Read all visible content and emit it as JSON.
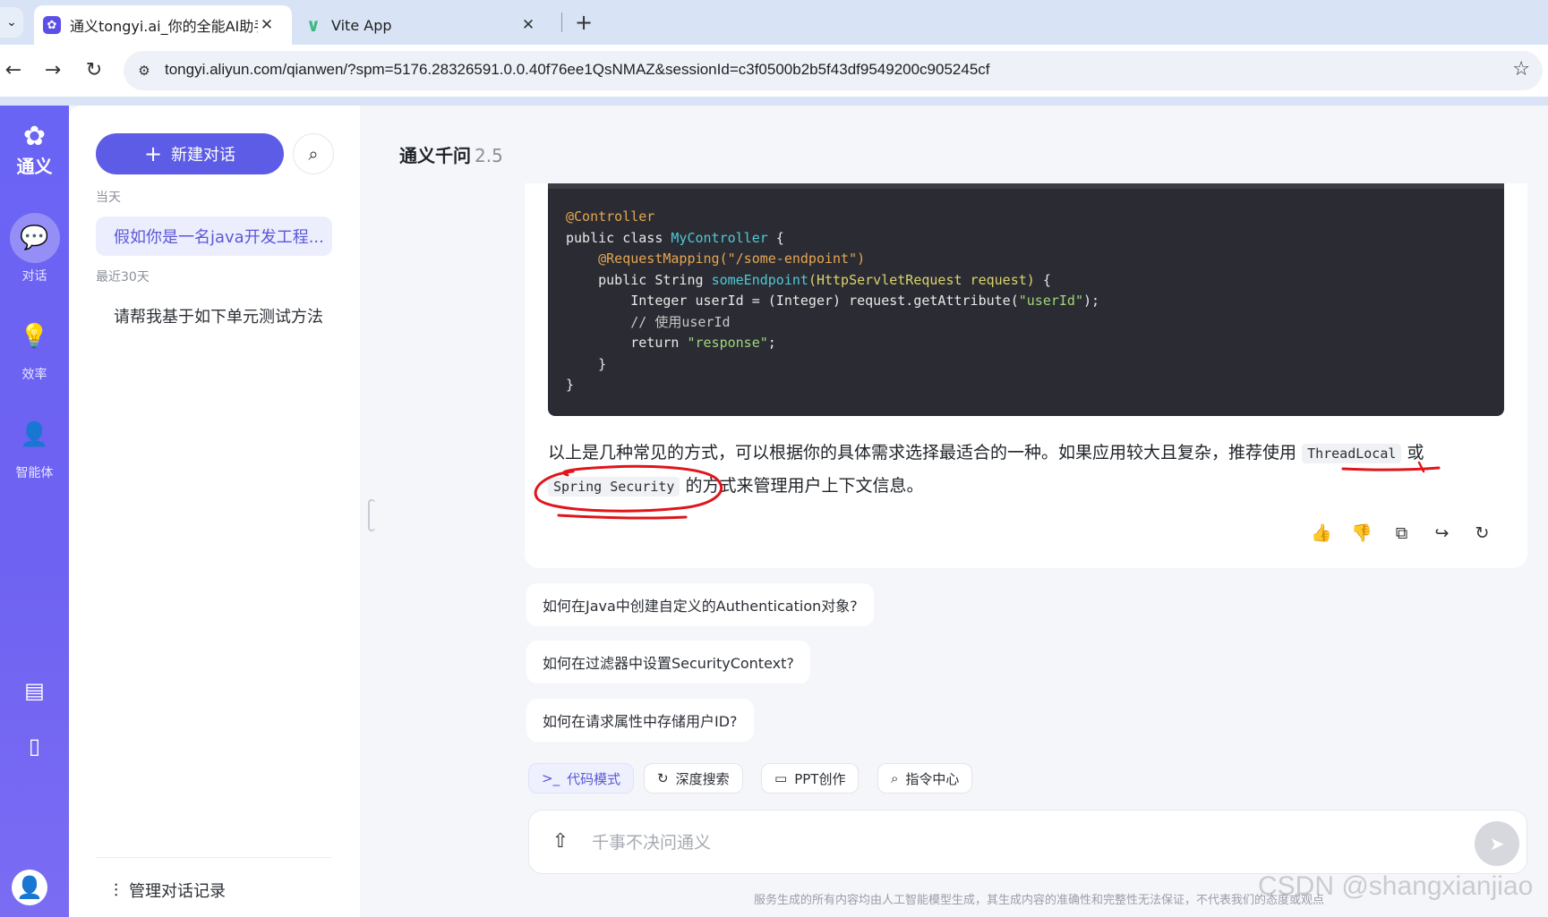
{
  "browser": {
    "tabs": [
      {
        "title": "通义tongyi.ai_你的全能AI助手-",
        "favicon": "tongyi-logo-icon",
        "active": true
      },
      {
        "title": "Vite App",
        "favicon": "vite-logo-icon",
        "active": false
      }
    ],
    "url": "tongyi.aliyun.com/qianwen/?spm=5176.28326591.0.0.40f76ee1QsNMAZ&sessionId=c3f0500b2b5f43df9549200c905245cf"
  },
  "rail": {
    "logo_text": "通义",
    "items": [
      {
        "label": "对话",
        "icon": "chat-bubble-icon",
        "active": true
      },
      {
        "label": "效率",
        "icon": "lightbulb-icon",
        "active": false
      },
      {
        "label": "智能体",
        "icon": "agent-icon",
        "active": false
      }
    ],
    "bottom_icons": [
      "document-icon",
      "mobile-icon",
      "user-avatar-icon"
    ]
  },
  "sidebar": {
    "new_chat_label": "新建对话",
    "groups": [
      {
        "label": "当天",
        "items": [
          "假如你是一名java开发工程..."
        ]
      },
      {
        "label": "最近30天",
        "items": [
          "请帮我基于如下单元测试方法"
        ]
      }
    ],
    "manage_label": "管理对话记录"
  },
  "main": {
    "model_name": "通义千问",
    "model_version": "2.5",
    "code_lines": [
      "@Controller",
      "public class MyController {",
      "    @RequestMapping(\"/some-endpoint\")",
      "    public String someEndpoint(HttpServletRequest request) {",
      "        Integer userId = (Integer) request.getAttribute(\"userId\");",
      "        // 使用userId",
      "        return \"response\";",
      "    }",
      "}"
    ],
    "answer": {
      "part1": "以上是几种常见的方式，可以根据你的具体需求选择最适合的一种。如果应用较大且复杂，推荐使用",
      "code1": "ThreadLocal",
      "part2": "或",
      "code2": "Spring Security",
      "part3": "的方式来管理用户上下文信息。"
    },
    "suggestions": [
      "如何在Java中创建自定义的Authentication对象?",
      "如何在过滤器中设置SecurityContext?",
      "如何在请求属性中存储用户ID?"
    ],
    "chips": [
      {
        "label": "代码模式",
        "icon": ">_",
        "active": true
      },
      {
        "label": "深度搜索",
        "icon": "↻",
        "active": false
      },
      {
        "label": "PPT创作",
        "icon": "▭",
        "active": false
      },
      {
        "label": "指令中心",
        "icon": "⌕",
        "active": false
      }
    ],
    "input_placeholder": "千事不决问通义",
    "disclaimer": "服务生成的所有内容均由人工智能模型生成，其生成内容的准确性和完整性无法保证，不代表我们的态度或观点",
    "watermark": "CSDN @shangxianjiao"
  },
  "colors": {
    "accent": "#5c5ce6",
    "rail": "#6a64f4",
    "annotation": "#e0151b"
  }
}
